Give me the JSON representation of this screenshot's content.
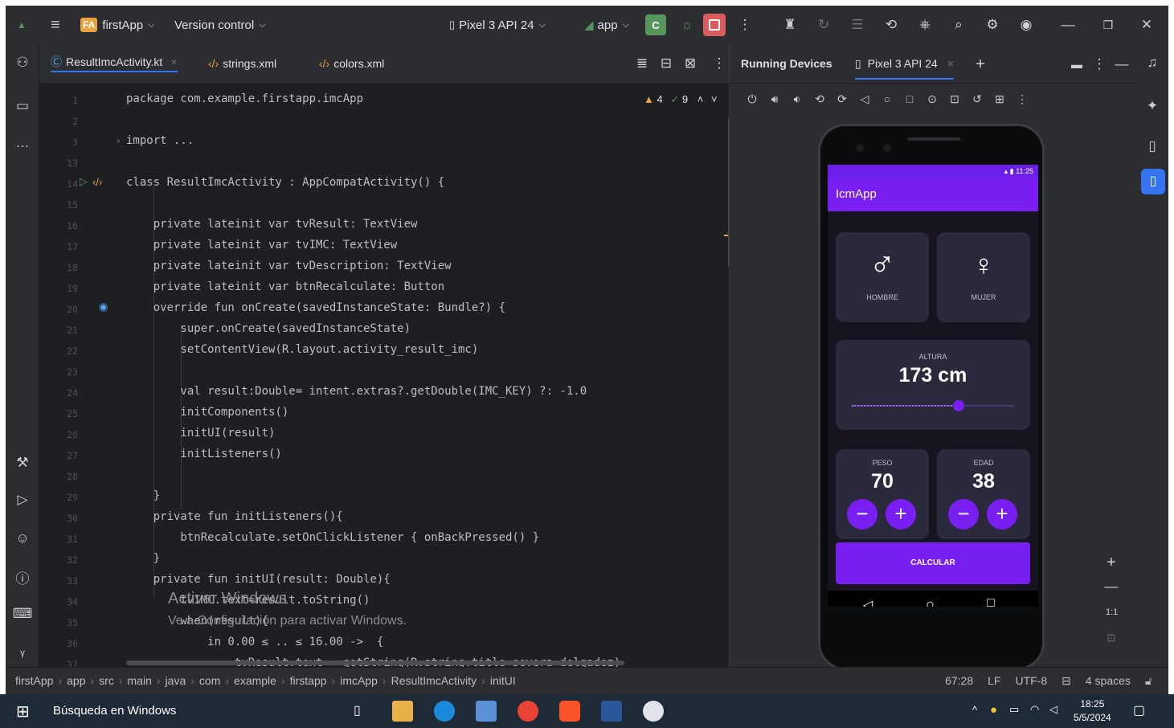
{
  "titlebar": {
    "project_badge": "FA",
    "project_name": "firstApp",
    "vcs": "Version control",
    "device": "Pixel 3 API 24",
    "run_config": "app",
    "more": "⋮"
  },
  "editor_tabs": [
    {
      "label": "ResultImcActivity.kt",
      "active": true
    },
    {
      "label": "strings.xml"
    },
    {
      "label": "colors.xml"
    }
  ],
  "inspections": {
    "warnings": "4",
    "weak_warnings": "9"
  },
  "code_lines": [
    {
      "n": "1",
      "text": "package com.example.firstapp.imcApp"
    },
    {
      "n": "2",
      "text": ""
    },
    {
      "n": "3",
      "text": "import ..."
    },
    {
      "n": "13",
      "text": ""
    },
    {
      "n": "14",
      "text": "class ResultImcActivity : AppCompatActivity() {"
    },
    {
      "n": "15",
      "text": ""
    },
    {
      "n": "16",
      "text": "    private lateinit var tvResult: TextView"
    },
    {
      "n": "17",
      "text": "    private lateinit var tvIMC: TextView"
    },
    {
      "n": "18",
      "text": "    private lateinit var tvDescription: TextView"
    },
    {
      "n": "19",
      "text": "    private lateinit var btnRecalculate: Button"
    },
    {
      "n": "20",
      "text": "    override fun onCreate(savedInstanceState: Bundle?) {"
    },
    {
      "n": "21",
      "text": "        super.onCreate(savedInstanceState)"
    },
    {
      "n": "22",
      "text": "        setContentView(R.layout.activity_result_imc)"
    },
    {
      "n": "23",
      "text": ""
    },
    {
      "n": "24",
      "text": "        val result:Double= intent.extras?.getDouble(IMC_KEY) ?: -1.0"
    },
    {
      "n": "25",
      "text": "        initComponents()"
    },
    {
      "n": "26",
      "text": "        initUI(result)"
    },
    {
      "n": "27",
      "text": "        initListeners()"
    },
    {
      "n": "28",
      "text": ""
    },
    {
      "n": "29",
      "text": "    }"
    },
    {
      "n": "30",
      "text": "    private fun initListeners(){"
    },
    {
      "n": "31",
      "text": "        btnRecalculate.setOnClickListener { onBackPressed() }"
    },
    {
      "n": "32",
      "text": "    }"
    },
    {
      "n": "33",
      "text": "    private fun initUI(result: Double){"
    },
    {
      "n": "34",
      "text": "        tvIMC.text=result.toString()"
    },
    {
      "n": "35",
      "text": "        when(result){"
    },
    {
      "n": "36",
      "text": "            in 0.00 ≤ .. ≤ 16.00 ->  {"
    },
    {
      "n": "37",
      "text": "                tvResult.text = getString(R.string.title_severa_delgadez)"
    }
  ],
  "running_devices": {
    "title": "Running Devices",
    "device_tab": "Pixel 3 API 24",
    "zoom_label": "1:1"
  },
  "phone": {
    "time": "11:25",
    "app_title": "IcmApp",
    "male_label": "HOMBRE",
    "female_label": "MUJER",
    "height_label": "ALTURA",
    "height_value": "173 cm",
    "height_slider_fraction": 0.66,
    "weight_label": "PESO",
    "weight_value": "70",
    "age_label": "EDAD",
    "age_value": "38",
    "calc_button": "CALCULAR",
    "minus": "−",
    "plus": "+"
  },
  "watermark": {
    "line1": "Activar Windows",
    "line2": "Ve a Configuración para activar Windows."
  },
  "breadcrumb": [
    "firstApp",
    "app",
    "src",
    "main",
    "java",
    "com",
    "example",
    "firstapp",
    "imcApp",
    "ResultImcActivity",
    "initUI"
  ],
  "statusbar": {
    "position": "67:28",
    "line_sep": "LF",
    "encoding": "UTF-8",
    "indent": "4 spaces"
  },
  "taskbar": {
    "search_placeholder": "Búsqueda en Windows",
    "time": "18:25",
    "date": "5/5/2024"
  },
  "colors": {
    "accent": "#7a1ff2",
    "ide_bg": "#1e1f22",
    "panel_bg": "#2b2d30"
  }
}
